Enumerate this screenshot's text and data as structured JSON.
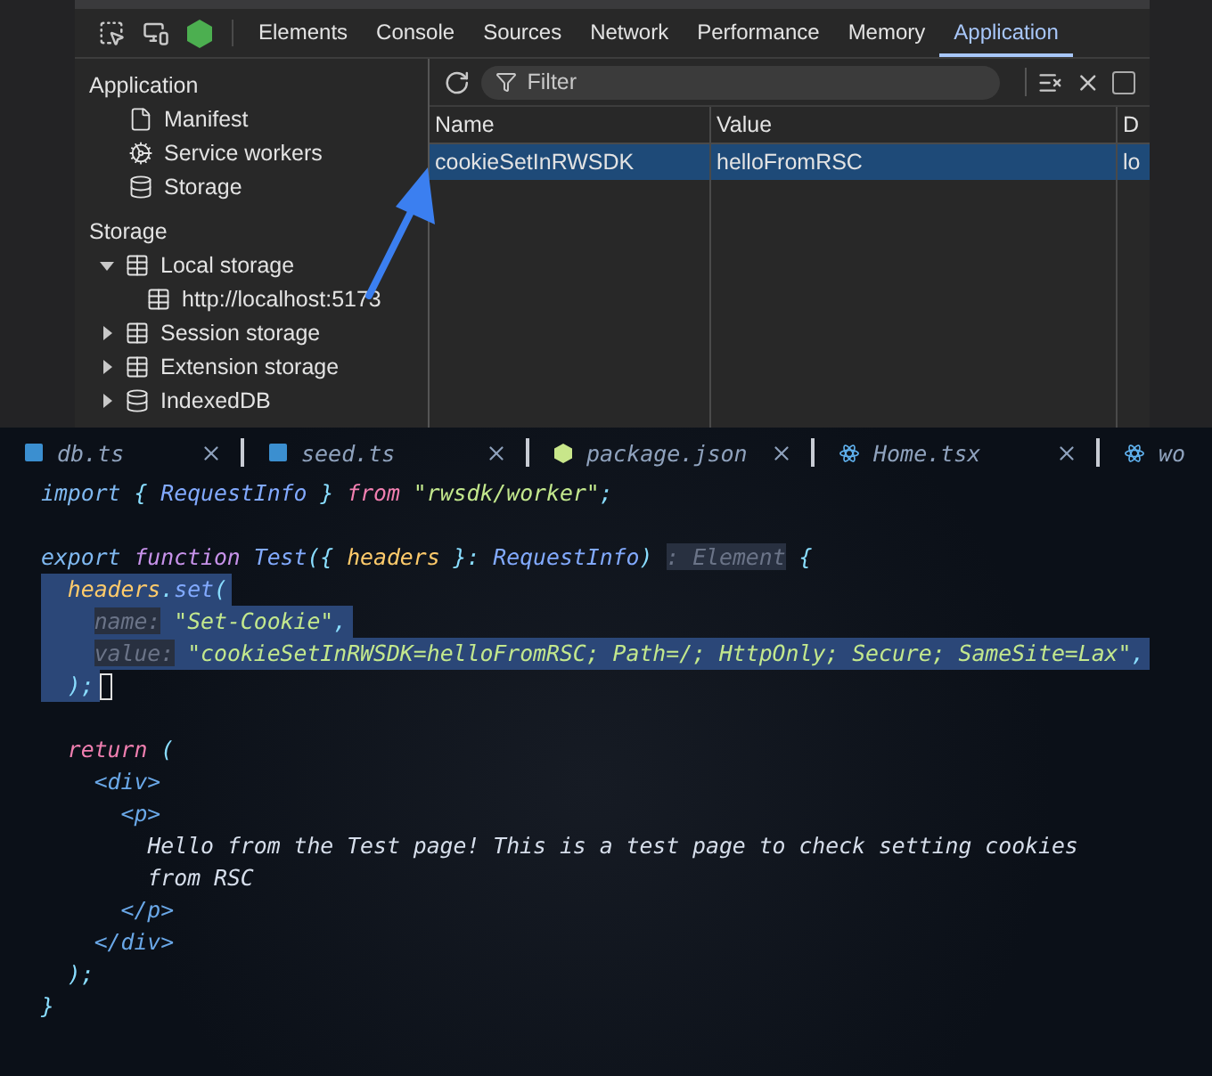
{
  "devtools": {
    "tabs": [
      {
        "label": "Elements",
        "selected": false
      },
      {
        "label": "Console",
        "selected": false
      },
      {
        "label": "Sources",
        "selected": false
      },
      {
        "label": "Network",
        "selected": false
      },
      {
        "label": "Performance",
        "selected": false
      },
      {
        "label": "Memory",
        "selected": false
      },
      {
        "label": "Application",
        "selected": true
      }
    ],
    "sidebar": [
      {
        "title": "Application",
        "items": [
          {
            "label": "Manifest",
            "kind": "file"
          },
          {
            "label": "Service workers",
            "kind": "gears"
          },
          {
            "label": "Storage",
            "kind": "database"
          }
        ]
      },
      {
        "title": "Storage",
        "items": [
          {
            "label": "Local storage",
            "kind": "table",
            "expanded": true,
            "children": [
              {
                "label": "http://localhost:5173",
                "kind": "table"
              }
            ]
          },
          {
            "label": "Session storage",
            "kind": "table",
            "expanded": false
          },
          {
            "label": "Extension storage",
            "kind": "table",
            "expanded": false
          },
          {
            "label": "IndexedDB",
            "kind": "database",
            "expanded": false
          }
        ]
      }
    ],
    "filter": {
      "placeholder": "Filter"
    },
    "checkbox": {
      "checked": false
    },
    "table": {
      "columns": [
        "Name",
        "Value",
        "D"
      ],
      "rows": [
        {
          "cells": [
            "cookieSetInRWSDK",
            "helloFromRSC",
            "lo"
          ],
          "selected": true
        }
      ]
    }
  },
  "editor": {
    "tabs": [
      {
        "label": "db.ts",
        "kind": "ts"
      },
      {
        "label": "seed.ts",
        "kind": "ts"
      },
      {
        "label": "package.json",
        "kind": "json"
      },
      {
        "label": "Home.tsx",
        "kind": "react"
      },
      {
        "label": "wo",
        "kind": "react"
      }
    ],
    "lines": [
      {
        "kind": "code",
        "selected": false,
        "cursor": false,
        "tokens": [
          {
            "kind": "keyword",
            "text": "import"
          },
          {
            "kind": "punct",
            "text": " { "
          },
          {
            "kind": "type",
            "text": "RequestInfo"
          },
          {
            "kind": "punct",
            "text": " } "
          },
          {
            "kind": "control",
            "text": "from"
          },
          {
            "kind": "string",
            "text": " \"rwsdk/worker\""
          },
          {
            "kind": "punct",
            "text": ";"
          }
        ]
      },
      {
        "kind": "blank"
      },
      {
        "kind": "code",
        "selected": false,
        "cursor": false,
        "tokens": [
          {
            "kind": "keyword",
            "text": "export "
          },
          {
            "kind": "storage",
            "text": "function "
          },
          {
            "kind": "type",
            "text": "Test"
          },
          {
            "kind": "punct",
            "text": "({ "
          },
          {
            "kind": "param",
            "text": "headers"
          },
          {
            "kind": "punct",
            "text": " }: "
          },
          {
            "kind": "type",
            "text": "RequestInfo"
          },
          {
            "kind": "punct",
            "text": ") "
          },
          {
            "kind": "hint",
            "text": ": Element"
          },
          {
            "kind": "punct",
            "text": " {"
          }
        ]
      },
      {
        "kind": "code",
        "selected": true,
        "cursor": false,
        "tokens": [
          {
            "kind": "param",
            "text": "  headers"
          },
          {
            "kind": "punct",
            "text": "."
          },
          {
            "kind": "type",
            "text": "set"
          },
          {
            "kind": "punct",
            "text": "("
          }
        ]
      },
      {
        "kind": "code",
        "selected": true,
        "cursor": false,
        "tokens": [
          {
            "kind": "hint",
            "text": "    name:"
          },
          {
            "kind": "string",
            "text": " \"Set-Cookie\""
          },
          {
            "kind": "punct",
            "text": ","
          }
        ]
      },
      {
        "kind": "code",
        "selected": true,
        "cursor": false,
        "tokens": [
          {
            "kind": "hint",
            "text": "    value:"
          },
          {
            "kind": "string",
            "text": " \"cookieSetInRWSDK=helloFromRSC; Path=/; HttpOnly; Secure; SameSite=Lax\""
          },
          {
            "kind": "punct",
            "text": ","
          }
        ]
      },
      {
        "kind": "code",
        "selected": true,
        "cursor": true,
        "tokens": [
          {
            "kind": "punct",
            "text": "  );"
          }
        ]
      },
      {
        "kind": "blank"
      },
      {
        "kind": "code",
        "selected": false,
        "cursor": false,
        "tokens": [
          {
            "kind": "control",
            "text": "  return"
          },
          {
            "kind": "punct",
            "text": " ("
          }
        ]
      },
      {
        "kind": "code",
        "selected": false,
        "cursor": false,
        "tokens": [
          {
            "kind": "tag",
            "text": "    <div>"
          }
        ]
      },
      {
        "kind": "code",
        "selected": false,
        "cursor": false,
        "tokens": [
          {
            "kind": "tag",
            "text": "      <p>"
          }
        ]
      },
      {
        "kind": "code",
        "selected": false,
        "cursor": false,
        "tokens": [
          {
            "kind": "text",
            "text": "        Hello from the Test page! This is a test page to check setting cookies"
          }
        ]
      },
      {
        "kind": "code",
        "selected": false,
        "cursor": false,
        "tokens": [
          {
            "kind": "text",
            "text": "        from RSC"
          }
        ]
      },
      {
        "kind": "code",
        "selected": false,
        "cursor": false,
        "tokens": [
          {
            "kind": "tag",
            "text": "      </p>"
          }
        ]
      },
      {
        "kind": "code",
        "selected": false,
        "cursor": false,
        "tokens": [
          {
            "kind": "tag",
            "text": "    </div>"
          }
        ]
      },
      {
        "kind": "code",
        "selected": false,
        "cursor": false,
        "tokens": [
          {
            "kind": "punct",
            "text": "  );"
          }
        ]
      },
      {
        "kind": "code",
        "selected": false,
        "cursor": false,
        "tokens": [
          {
            "kind": "punct",
            "text": "}"
          }
        ]
      }
    ]
  }
}
